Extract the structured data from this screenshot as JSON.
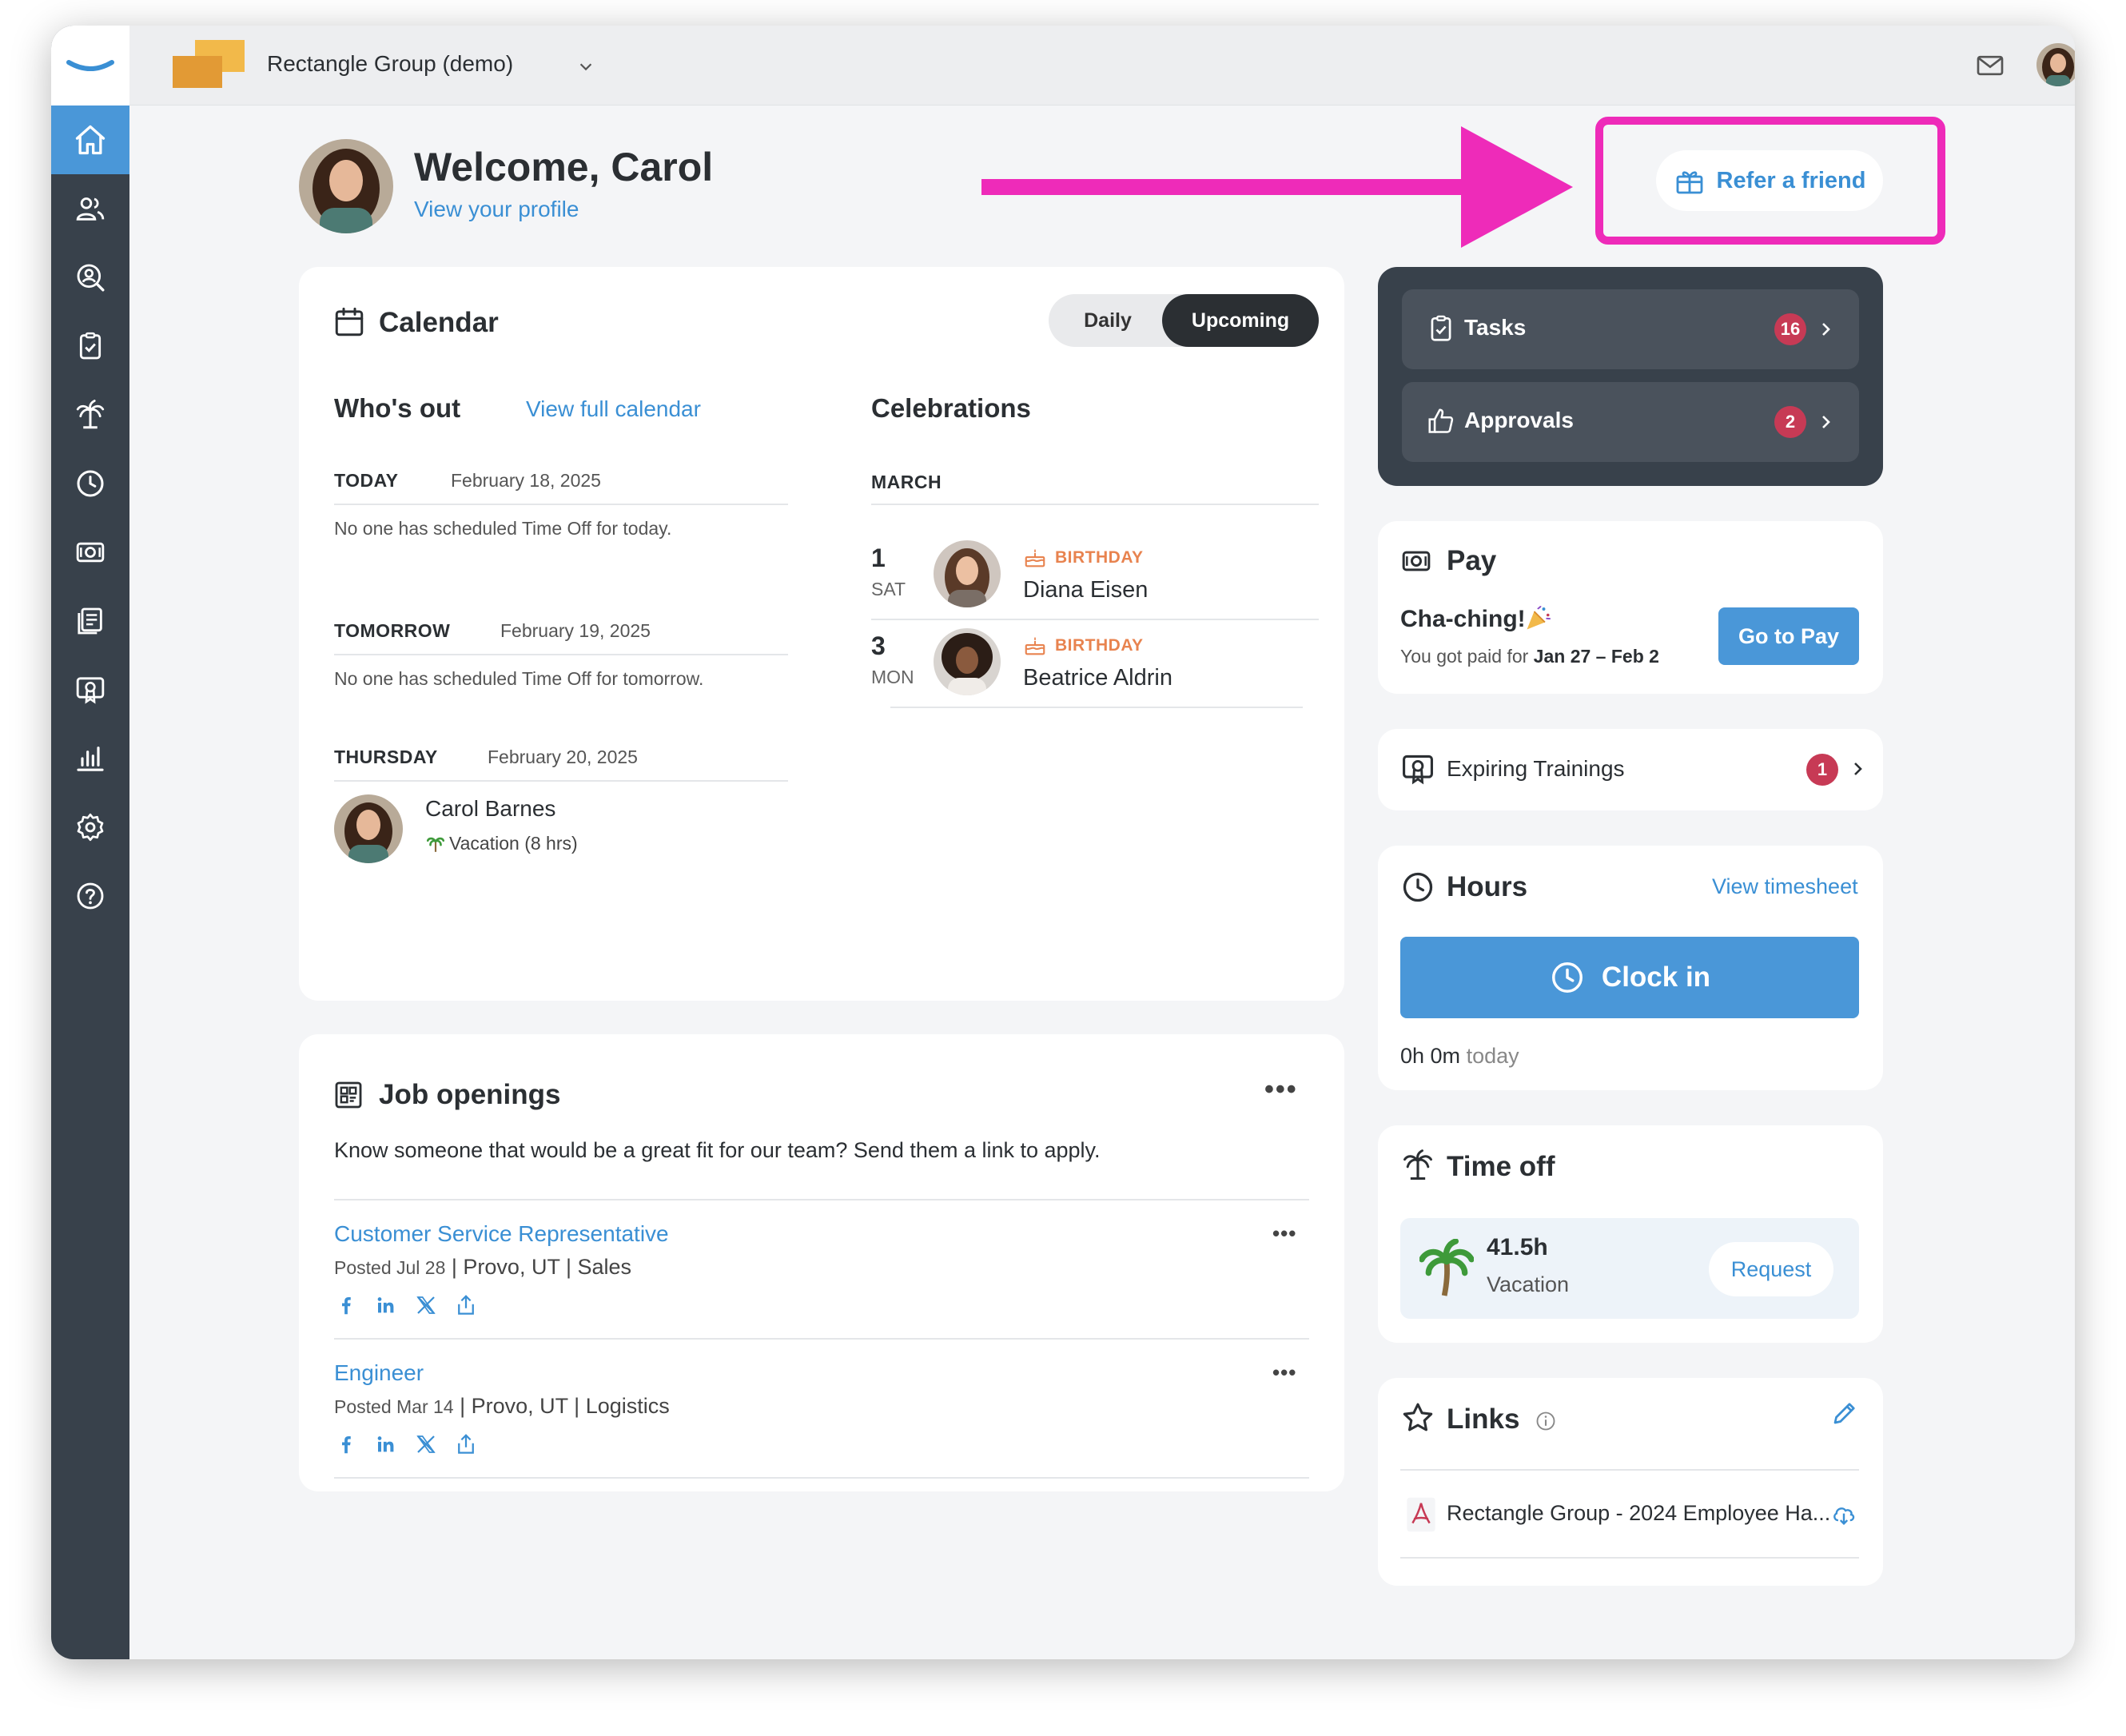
{
  "topbar": {
    "company_name": "Rectangle Group (demo)"
  },
  "welcome": {
    "title": "Welcome, Carol",
    "profile_link": "View your profile"
  },
  "refer": {
    "label": "Refer a friend"
  },
  "calendar": {
    "title": "Calendar",
    "toggle_daily": "Daily",
    "toggle_upcoming": "Upcoming",
    "whos_out_title": "Who's out",
    "view_full_link": "View full calendar",
    "days": [
      {
        "label": "TODAY",
        "date": "February 18, 2025",
        "note": "No one has scheduled Time Off for today."
      },
      {
        "label": "TOMORROW",
        "date": "February 19, 2025",
        "note": "No one has scheduled Time Off for tomorrow."
      },
      {
        "label": "THURSDAY",
        "date": "February 20, 2025",
        "person_name": "Carol Barnes",
        "person_detail": "Vacation (8 hrs)"
      }
    ],
    "celebrations_title": "Celebrations",
    "month": "MARCH",
    "celebrations": [
      {
        "day": "1",
        "weekday": "SAT",
        "type": "BIRTHDAY",
        "name": "Diana Eisen"
      },
      {
        "day": "3",
        "weekday": "MON",
        "type": "BIRTHDAY",
        "name": "Beatrice Aldrin"
      }
    ]
  },
  "jobs": {
    "title": "Job openings",
    "intro": "Know someone that would be a great fit for our team? Send them a link to apply.",
    "items": [
      {
        "title": "Customer Service Representative",
        "posted": "Posted Jul 28",
        "location": "Provo, UT",
        "dept": "Sales"
      },
      {
        "title": "Engineer",
        "posted": "Posted Mar 14",
        "location": "Provo, UT",
        "dept": "Logistics"
      }
    ]
  },
  "tasks": {
    "label": "Tasks",
    "count": "16"
  },
  "approvals": {
    "label": "Approvals",
    "count": "2"
  },
  "pay": {
    "title": "Pay",
    "headline": "Cha-ching!",
    "subtitle_prefix": "You got paid for",
    "period": "Jan 27 – Feb 2",
    "button": "Go to Pay"
  },
  "trainings": {
    "label": "Expiring Trainings",
    "count": "1"
  },
  "hours": {
    "title": "Hours",
    "timesheet_link": "View timesheet",
    "clock_button": "Clock in",
    "total": "0h 0m",
    "total_suffix": "today"
  },
  "timeoff": {
    "title": "Time off",
    "balance": "41.5h",
    "type": "Vacation",
    "request_button": "Request"
  },
  "links": {
    "title": "Links",
    "items": [
      {
        "label": "Rectangle Group - 2024 Employee Ha..."
      }
    ]
  },
  "colors": {
    "accent": "#4a97d8",
    "sidebar": "#38414b",
    "badge": "#c73a55",
    "annotation": "#ee2bb9",
    "birthday": "#e8834f"
  }
}
